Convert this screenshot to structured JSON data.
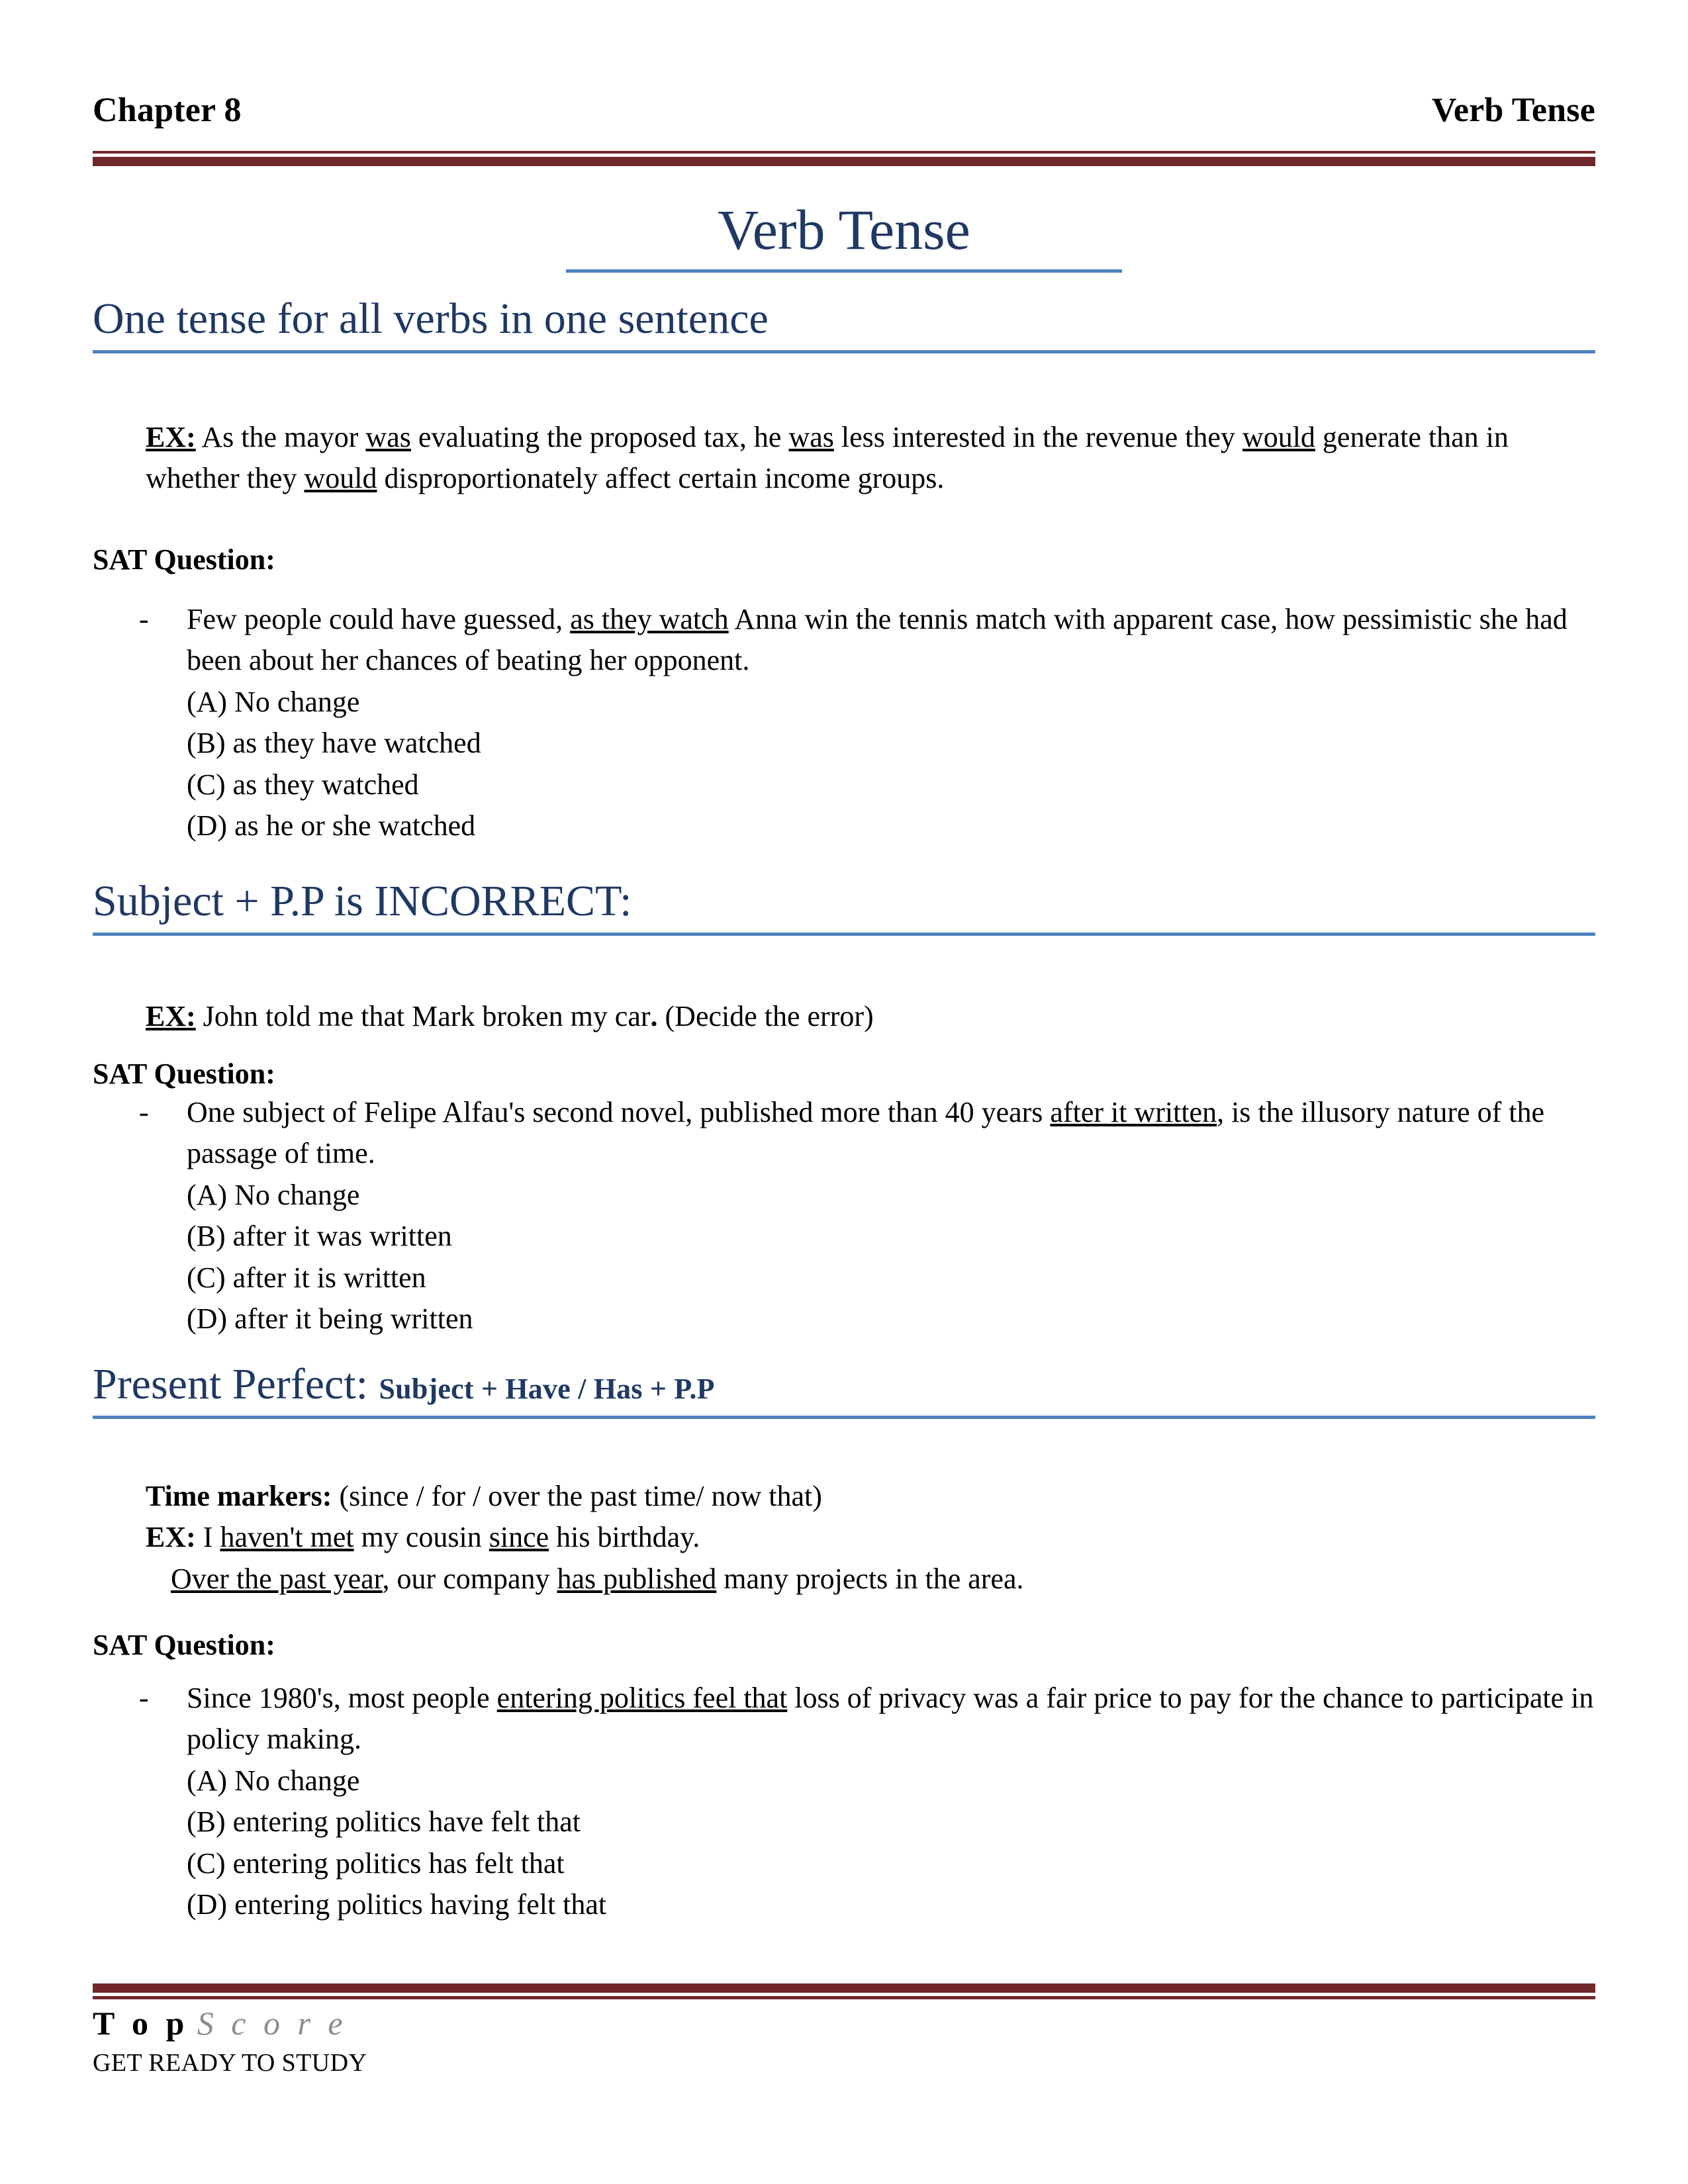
{
  "header": {
    "chapter": "Chapter 8",
    "topic": "Verb Tense"
  },
  "title": "Verb Tense",
  "sections": [
    {
      "heading": "One tense for all verbs in one sentence",
      "example_label": "EX:",
      "example_line1_a": " As the mayor ",
      "example_u1": "was",
      "example_line1_b": " evaluating the proposed tax, he ",
      "example_u2": "was",
      "example_line1_c": " less interested in the revenue they",
      "example_u3": "would",
      "example_line2_b": " generate than in whether they ",
      "example_u4": "would",
      "example_line2_c": " disproportionately affect certain income groups.",
      "sat_label": "SAT Question:",
      "bullet": "-",
      "question_a": "Few people could have guessed, ",
      "question_u": "as they watch",
      "question_b": " Anna win the tennis match with apparent case, how pessimistic she had been about her chances of beating her opponent.",
      "options": [
        "(A) No change",
        "(B) as they have watched",
        "(C) as they watched",
        "(D) as he or she watched"
      ]
    },
    {
      "heading": "Subject + P.P is INCORRECT:",
      "example_label": "EX:",
      "example_text_a": " John told me that Mark broken my car",
      "example_period": ".",
      "example_text_b": " (Decide the error)",
      "sat_label": "SAT Question:",
      "bullet": "-",
      "question_a": "One subject of  Felipe Alfau's second novel, published more than 40 years ",
      "question_u": "after it written",
      "question_b": ", is the illusory nature of the passage of time.",
      "options": [
        "(A) No change",
        "(B) after it was written",
        "(C) after it is written",
        "(D) after it being written"
      ]
    },
    {
      "heading_main": "Present Perfect:",
      "heading_sub": "Subject + Have / Has + P.P",
      "time_markers_label": "Time markers:",
      "time_markers_value": " (since / for / over the past time/ now that)",
      "example_label": "EX:",
      "example_line1_a": " I ",
      "example_line1_u1": "haven't met",
      "example_line1_b": " my cousin ",
      "example_line1_u2": "since",
      "example_line1_c": " his birthday.",
      "example_line2_u1": "Over the past year",
      "example_line2_b": ", our company ",
      "example_line2_u2": "has published",
      "example_line2_c": " many projects in the area.",
      "sat_label": "SAT Question:",
      "bullet": "-",
      "question_a": "Since 1980's, most people ",
      "question_u": "entering politics feel that",
      "question_b": " loss of privacy was a fair price to pay for the chance to participate in policy making.",
      "options": [
        "(A) No change",
        "(B) entering politics have felt that",
        "(C) entering politics has felt that",
        "(D) entering politics having felt that"
      ]
    }
  ],
  "footer": {
    "brand_top": "T o p",
    "brand_score": "S c o r e",
    "tagline": "GET READY TO STUDY"
  },
  "colors": {
    "navy": "#1f3864",
    "accent_blue": "#4f81bd",
    "maroon": "#70272b",
    "gray": "#8c8c8c"
  }
}
